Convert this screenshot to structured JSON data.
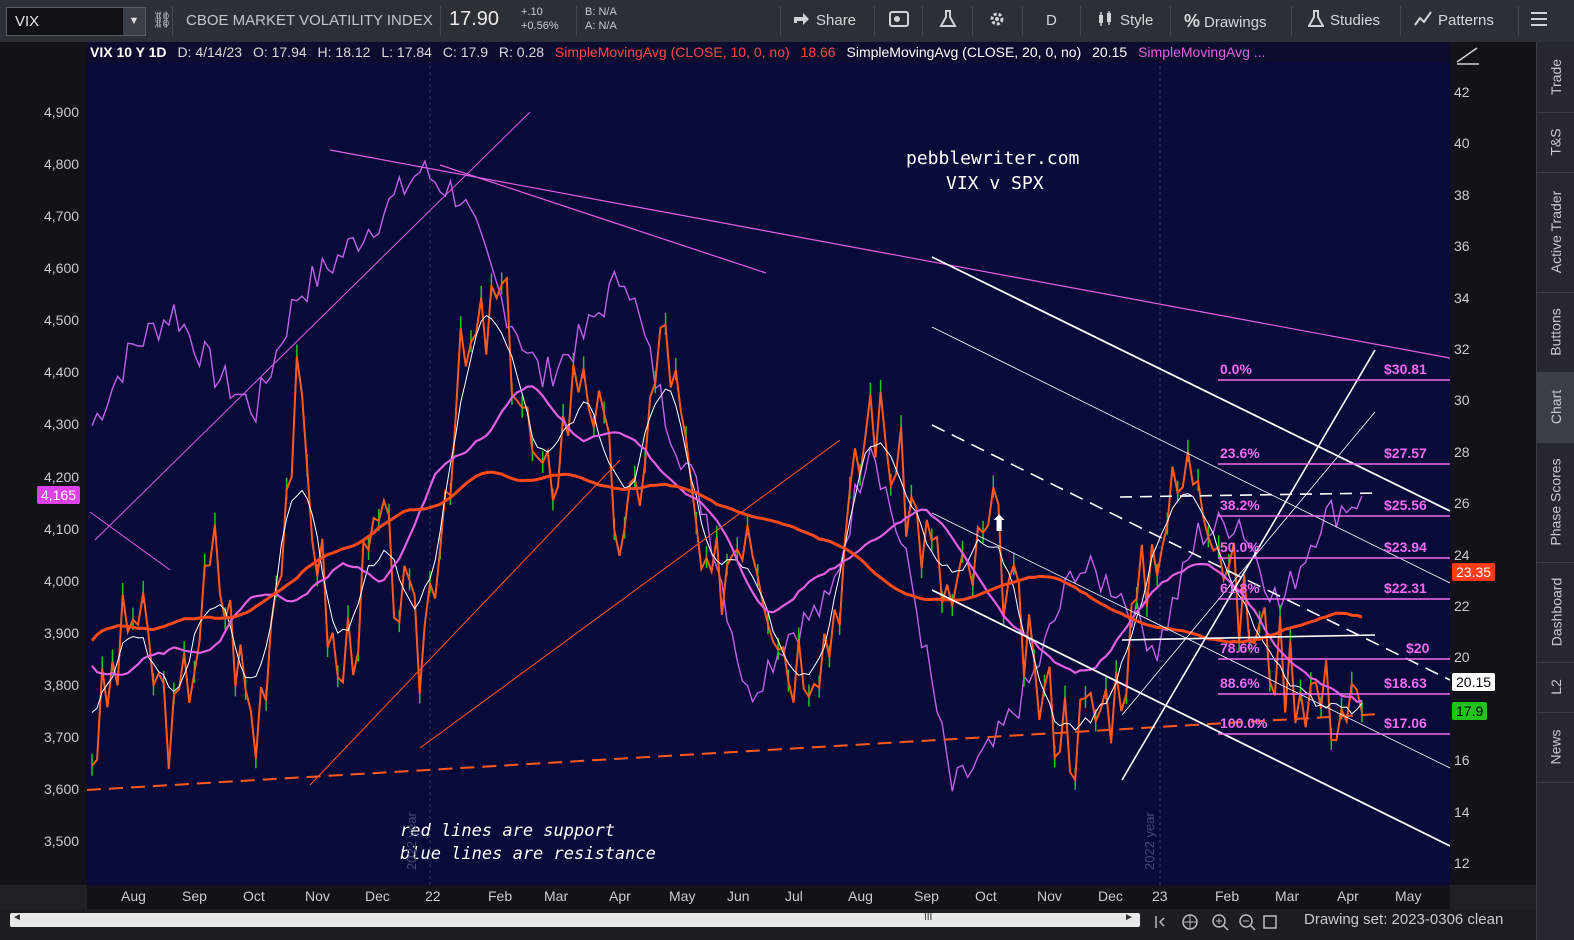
{
  "toolbar": {
    "symbol": "VIX",
    "symbol_caret": "▼",
    "link_icon": "⛓",
    "instrument_name": "CBOE MARKET VOLATILITY INDEX",
    "last_price": "17.90",
    "change_abs": "+.10",
    "change_pct": "+0.56%",
    "bid": "B: N/A",
    "ask": "A: N/A",
    "share_label": "Share",
    "period_label": "D",
    "style_label": "Style",
    "drawings_label": "Drawings",
    "studies_label": "Studies",
    "patterns_label": "Patterns"
  },
  "chart_header": {
    "title": "VIX 10 Y 1D",
    "date": "D: 4/14/23",
    "open": "O: 17.94",
    "high": "H: 18.12",
    "low": "L: 17.84",
    "close": "C: 17.9",
    "range": "R: 0.28",
    "sma10_label": "SimpleMovingAvg (CLOSE, 10, 0, no)",
    "sma10_value": "18.66",
    "sma20_label": "SimpleMovingAvg (CLOSE, 20, 0, no)",
    "sma20_value": "20.15",
    "sma3_label": "SimpleMovingAvg ..."
  },
  "annotations": {
    "site": "pebblewriter.com",
    "subtitle": "VIX v SPX",
    "note_red": "red lines are support",
    "note_blue": "blue lines are resistance",
    "year_2021": "2022 year",
    "year_2022": "2022 year"
  },
  "fib_levels": [
    {
      "pct": "0.0%",
      "price": "$30.81"
    },
    {
      "pct": "23.6%",
      "price": "$27.57"
    },
    {
      "pct": "38.2%",
      "price": "$25.56"
    },
    {
      "pct": "50.0%",
      "price": "$23.94"
    },
    {
      "pct": "61.8%",
      "price": "$22.31"
    },
    {
      "pct": "78.6%",
      "price": "$20"
    },
    {
      "pct": "88.6%",
      "price": "$18.63"
    },
    {
      "pct": "100.0%",
      "price": "$17.06"
    }
  ],
  "price_tags": {
    "spx_tag": "4,165",
    "sma_red_tag": "23.35",
    "sma20_tag": "20.15",
    "last_tag": "17.9"
  },
  "colors": {
    "chart_bg": "#080a3a",
    "vix_up": "#22c422",
    "vix_sma10": "#ff5a1e",
    "spx": "#c060e8",
    "fib": "#f06cf0",
    "channel": "#ffffff"
  },
  "side_tabs": [
    "Trade",
    "T&S",
    "Active Trader",
    "Buttons",
    "Chart",
    "Phase Scores",
    "Dashboard",
    "L2",
    "News"
  ],
  "footer": {
    "drawing_set": "Drawing set: 2023-0306 clean",
    "scroll_left": "◄",
    "scroll_right": "►",
    "scroll_grip": "III"
  },
  "chart_data": {
    "type": "line",
    "title": "VIX 10 Y 1D",
    "x_labels": [
      "Aug",
      "Sep",
      "Oct",
      "Nov",
      "Dec",
      "22",
      "Feb",
      "Mar",
      "Apr",
      "May",
      "Jun",
      "Jul",
      "Aug",
      "Sep",
      "Oct",
      "Nov",
      "Dec",
      "23",
      "Feb",
      "Mar",
      "Apr",
      "May"
    ],
    "left_axis_label": "SPX",
    "left_ticks": [
      "4,900",
      "4,800",
      "4,700",
      "4,600",
      "4,500",
      "4,400",
      "4,300",
      "4,200",
      "4,100",
      "4,000",
      "3,900",
      "3,800",
      "3,700",
      "3,600",
      "3,500"
    ],
    "left_ylim": [
      3450,
      4950
    ],
    "right_axis_label": "VIX",
    "right_ticks": [
      "42",
      "40",
      "38",
      "36",
      "34",
      "32",
      "30",
      "28",
      "26",
      "24",
      "22",
      "20",
      "18",
      "16",
      "14",
      "12"
    ],
    "right_ylim": [
      11.5,
      43.5
    ],
    "series": [
      {
        "name": "VIX",
        "values": [
          16.5,
          22,
          17,
          24,
          17,
          30,
          19,
          25,
          20,
          31,
          34,
          26,
          32,
          24,
          33,
          22,
          26,
          20,
          21,
          30,
          26,
          22,
          25,
          19,
          17.06,
          18.8,
          25,
          28,
          22,
          20,
          18.6,
          17.9
        ]
      },
      {
        "name": "SPX",
        "values": [
          4300,
          4450,
          4520,
          4400,
          4330,
          4550,
          4620,
          4700,
          4790,
          4740,
          4540,
          4390,
          4470,
          4600,
          4320,
          4130,
          3780,
          3900,
          3960,
          4280,
          4000,
          3600,
          3680,
          3820,
          4030,
          3990,
          3870,
          4090,
          4120,
          3950,
          4120,
          4165
        ]
      },
      {
        "name": "SimpleMovingAvg (CLOSE, 10, 0, no)",
        "last": 18.66
      },
      {
        "name": "SimpleMovingAvg (CLOSE, 20, 0, no)",
        "last": 20.15
      }
    ]
  }
}
